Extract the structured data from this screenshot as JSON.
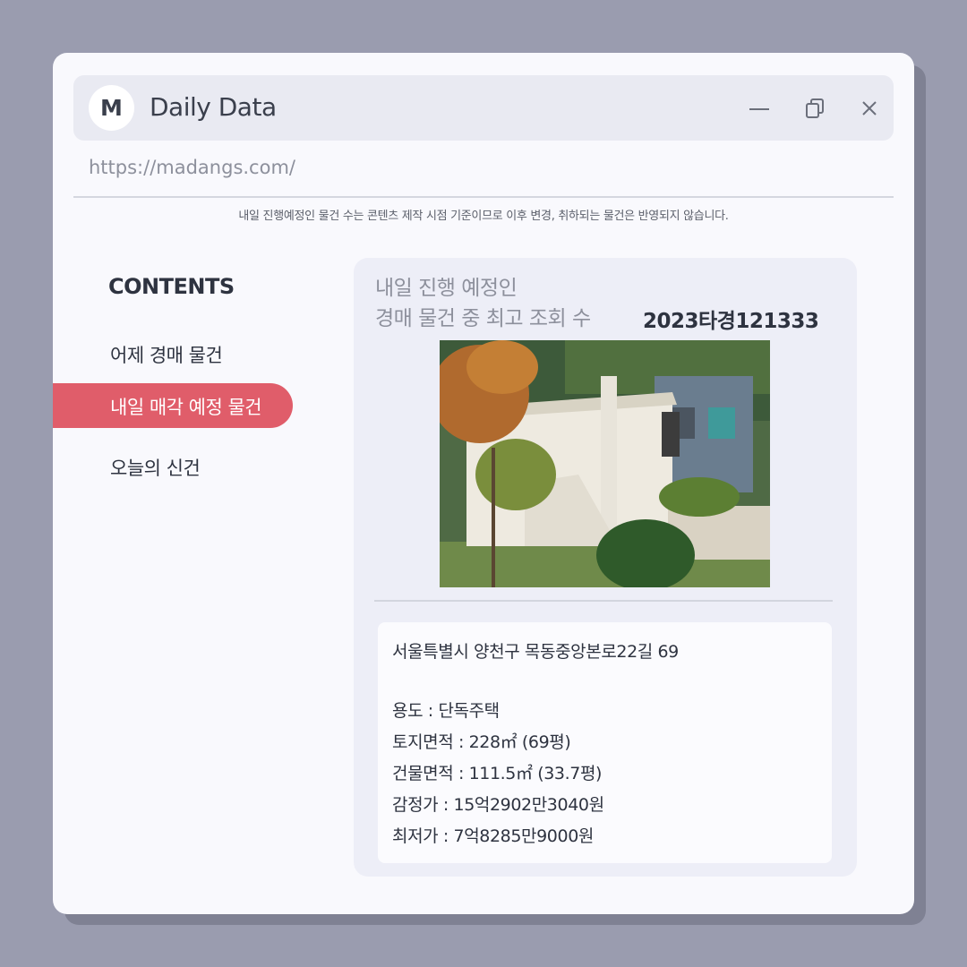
{
  "window": {
    "logo_letter": "M",
    "app_title": "Daily Data",
    "url": "https://madangs.com/",
    "notice": "내일 진행예정인 물건 수는 콘텐츠 제작 시점 기준이므로 이후 변경, 취하되는 물건은 반영되지 않습니다."
  },
  "sidebar": {
    "heading": "CONTENTS",
    "items": [
      {
        "label": "어제 경매 물건",
        "active": false
      },
      {
        "label": "내일 매각 예정 물건",
        "active": true
      },
      {
        "label": "오늘의 신건",
        "active": false
      }
    ]
  },
  "panel": {
    "title_line1": "내일 진행 예정인",
    "title_line2": "경매 물건 중 최고 조회 수",
    "case_number": "2023타경121333",
    "address": "서울특별시 양천구 목동중앙본로22길 69",
    "details": [
      "용도 : 단독주택",
      "토지면적 : 228㎡ (69평)",
      "건물면적 : 111.5㎡ (33.7평)",
      "감정가 : 15억2902만3040원",
      "최저가 : 7억8285만9000원"
    ]
  },
  "colors": {
    "background": "#9a9caf",
    "accent": "#e05d6a",
    "text": "#2e3340",
    "muted": "#8d909c"
  },
  "icons": [
    "minimize-icon",
    "restore-icon",
    "close-icon"
  ]
}
